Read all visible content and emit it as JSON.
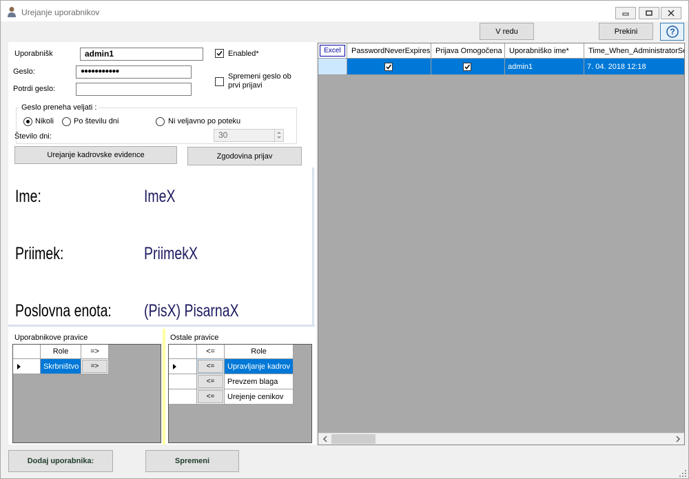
{
  "window": {
    "title": "Urejanje uporabnikov"
  },
  "toolbar": {
    "ok_label": "V redu",
    "cancel_label": "Prekini",
    "help_label": "?"
  },
  "form": {
    "username_label": "Uporabnišk",
    "username_value": "admin1",
    "password_label": "Geslo:",
    "password_value": "●●●●●●●●●●●",
    "confirm_label": "Potrdi geslo:",
    "confirm_value": "",
    "enabled_label": "Enabled*",
    "enabled_checked": true,
    "change_pw_label_1": "Spremeni geslo ob",
    "change_pw_label_2": "prvi prijavi",
    "change_pw_checked": false
  },
  "expiry": {
    "group_label": "Geslo preneha veljati :",
    "opt_never": "Nikoli",
    "opt_days": "Po številu dni",
    "opt_invalid": "Ni veljavno po poteku",
    "selected": "Nikoli",
    "days_label": "Število dni:",
    "days_value": "30"
  },
  "buttons": {
    "hr_edit": "Urejanje kadrovske evidence",
    "login_history": "Zgodovina prijav",
    "add_user": "Dodaj uporabnika:",
    "change": "Spremeni"
  },
  "info": {
    "name_label": "Ime:",
    "name_value": "ImeX",
    "surname_label": "Priimek:",
    "surname_value": "PriimekX",
    "unit_label": "Poslovna enota:",
    "unit_value": "(PisX) PisarnaX"
  },
  "user_rights": {
    "title": "Uporabnikove pravice",
    "header_role": "Role",
    "header_action": "=>",
    "rows": [
      {
        "role": "Skrbništvo",
        "action": "=>"
      }
    ]
  },
  "other_rights": {
    "title": "Ostale pravice",
    "header_action": "<=",
    "header_role": "Role",
    "rows": [
      {
        "action": "<=",
        "role": "Upravljanje kadrov"
      },
      {
        "action": "<=",
        "role": "Prevzem blaga"
      },
      {
        "action": "<=",
        "role": "Urejenje cenikov"
      }
    ]
  },
  "users_grid": {
    "excel_label": "Excel",
    "columns": [
      "PasswordNeverExpires",
      "Prijava Omogočena",
      "Uporabniško ime*",
      "Time_When_AdministratorSe"
    ],
    "rows": [
      {
        "never_expires": true,
        "login_enabled": true,
        "username": "admin1",
        "time": "7. 04. 2018 12:18"
      }
    ]
  }
}
